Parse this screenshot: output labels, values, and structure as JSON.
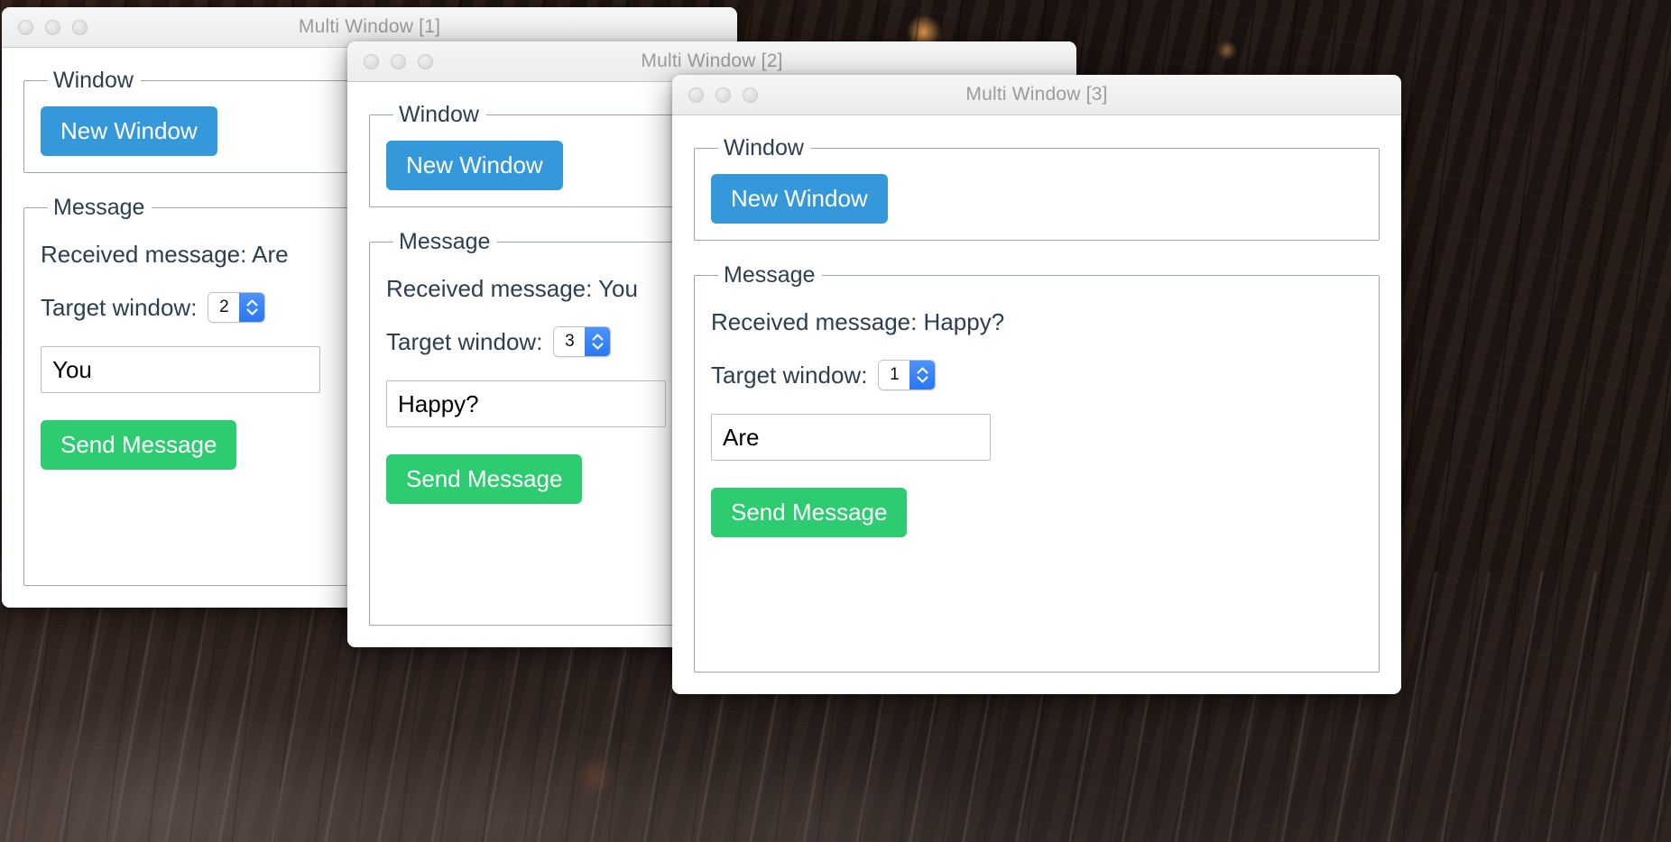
{
  "desktop": {
    "wallpaper_description": "dark night cityscape of old buildings",
    "colors": {
      "accent_blue": "#3498db",
      "accent_green": "#2ecc71",
      "stepper_blue": "#2a77f5",
      "group_border": "#9aa7a9",
      "text": "#2c3e50",
      "title_text": "#9b9b9b"
    }
  },
  "windows": [
    {
      "id": "1",
      "title": "Multi Window [1]",
      "traffic_lights": [
        "close",
        "minimize",
        "zoom"
      ],
      "window_group": {
        "legend": "Window",
        "new_window_label": "New Window"
      },
      "message_group": {
        "legend": "Message",
        "received_label": "Received message: Are",
        "target_label": "Target window:",
        "target_value": "2",
        "input_value": "You",
        "input_placeholder": "",
        "send_label": "Send Message"
      }
    },
    {
      "id": "2",
      "title": "Multi Window [2]",
      "traffic_lights": [
        "close",
        "minimize",
        "zoom"
      ],
      "window_group": {
        "legend": "Window",
        "new_window_label": "New Window"
      },
      "message_group": {
        "legend": "Message",
        "received_label": "Received message: You",
        "target_label": "Target window:",
        "target_value": "3",
        "input_value": "Happy?",
        "input_placeholder": "",
        "send_label": "Send Message"
      }
    },
    {
      "id": "3",
      "title": "Multi Window [3]",
      "traffic_lights": [
        "close",
        "minimize",
        "zoom"
      ],
      "window_group": {
        "legend": "Window",
        "new_window_label": "New Window"
      },
      "message_group": {
        "legend": "Message",
        "received_label": "Received message: Happy?",
        "target_label": "Target window:",
        "target_value": "1",
        "input_value": "Are",
        "input_placeholder": "",
        "send_label": "Send Message"
      }
    }
  ]
}
